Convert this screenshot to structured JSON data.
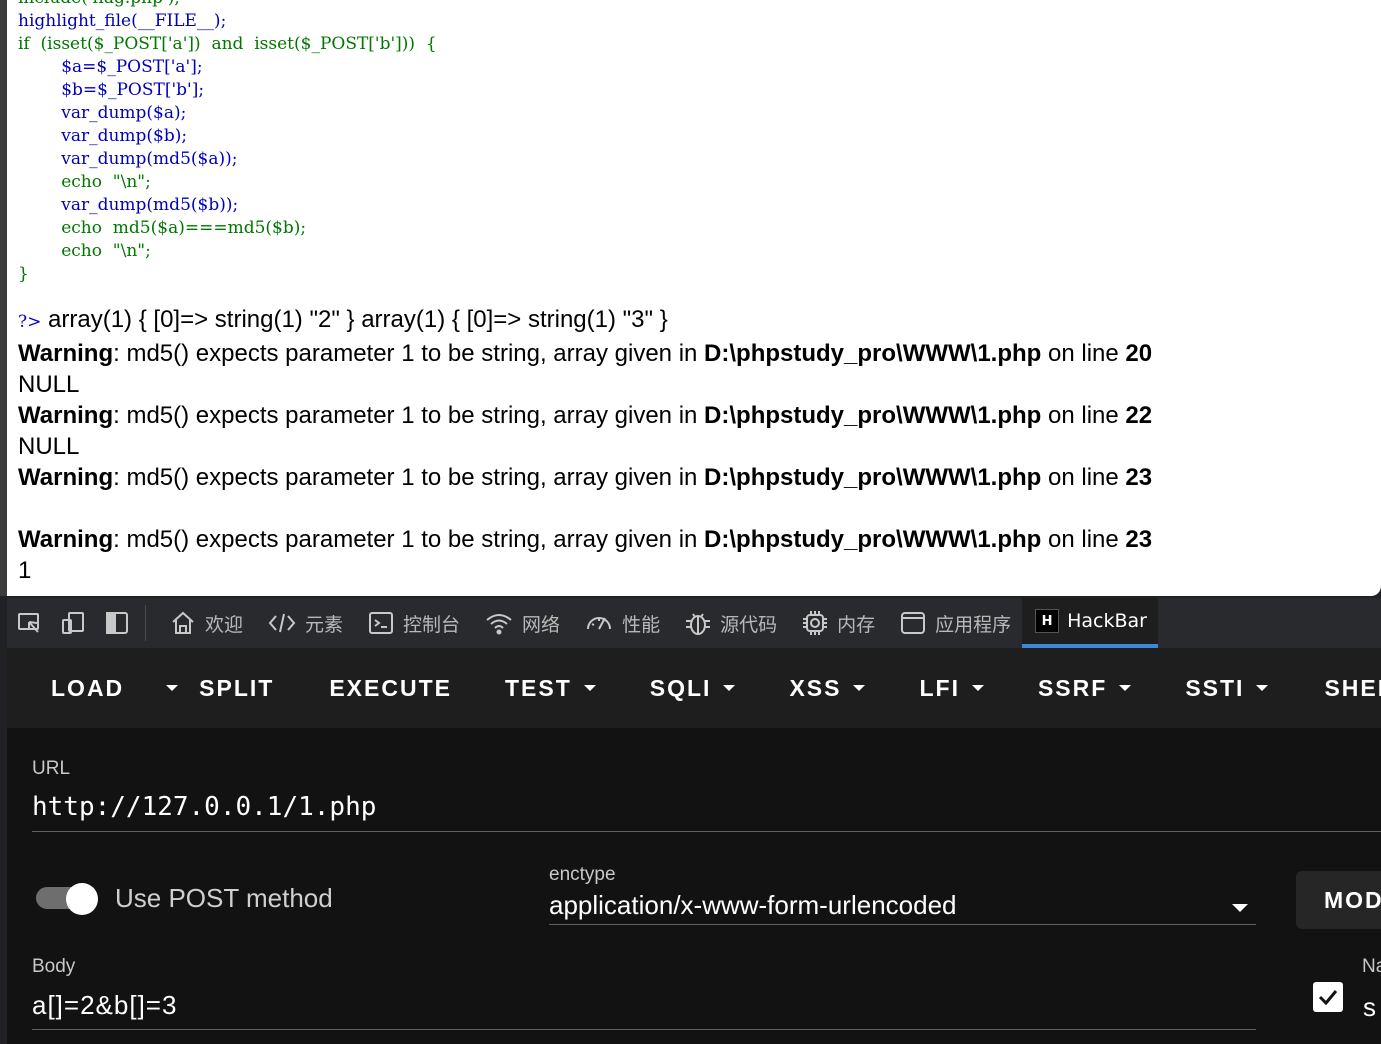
{
  "page": {
    "code_lines": [
      "include('flag.php');",
      "highlight_file(__FILE__);",
      "if  (isset($_POST['a'])  and  isset($_POST['b']))  {",
      "        $a=$_POST['a'];",
      "        $b=$_POST['b'];",
      "        var_dump($a);",
      "        var_dump($b);",
      "        var_dump(md5($a));",
      "        echo  \"\\n\";",
      "        var_dump(md5($b));",
      "        echo  md5($a)===md5($b);",
      "        echo  \"\\n\";",
      "}"
    ],
    "php_close_tag": "?>",
    "dump_line": "array(1) { [0]=> string(1) \"2\" } array(1) { [0]=> string(1) \"3\" }",
    "warning_label": "Warning",
    "warning_message": ": md5() expects parameter 1 to be string, array given in ",
    "file_path": "D:\\phpstudy_pro\\WWW\\1.php",
    "on_line_text": " on line ",
    "warnings": [
      {
        "line": "20",
        "after": "NULL"
      },
      {
        "line": "22",
        "after": "NULL"
      },
      {
        "line": "23",
        "after": ""
      },
      {
        "line": "23",
        "after": "1"
      }
    ]
  },
  "devtools": {
    "icons": [
      "inspect-icon",
      "device-toolbar-icon",
      "dock-side-icon"
    ],
    "tabs": [
      {
        "label": "欢迎",
        "icon": "home-icon"
      },
      {
        "label": "元素",
        "icon": "code-icon"
      },
      {
        "label": "控制台",
        "icon": "console-icon"
      },
      {
        "label": "网络",
        "icon": "wifi-icon"
      },
      {
        "label": "性能",
        "icon": "gauge-icon"
      },
      {
        "label": "源代码",
        "icon": "bug-icon"
      },
      {
        "label": "内存",
        "icon": "chip-icon"
      },
      {
        "label": "应用程序",
        "icon": "app-icon"
      },
      {
        "label": "HackBar",
        "icon": "hackbar-logo",
        "active": true
      }
    ],
    "hackbar_logo_letter": "H"
  },
  "hackbar": {
    "toolbar": [
      "LOAD",
      "SPLIT",
      "EXECUTE",
      "TEST",
      "SQLI",
      "XSS",
      "LFI",
      "SSRF",
      "SSTI",
      "SHELL"
    ],
    "url_label": "URL",
    "url_value": "http://127.0.0.1/1.php",
    "post_toggle_label": "Use POST method",
    "post_enabled": true,
    "enctype_label": "enctype",
    "enctype_value": "application/x-www-form-urlencoded",
    "mod_button": "MOD",
    "body_label": "Body",
    "body_value": "a[]=2&b[]=3",
    "name_label": "Na",
    "name_value": "s"
  }
}
